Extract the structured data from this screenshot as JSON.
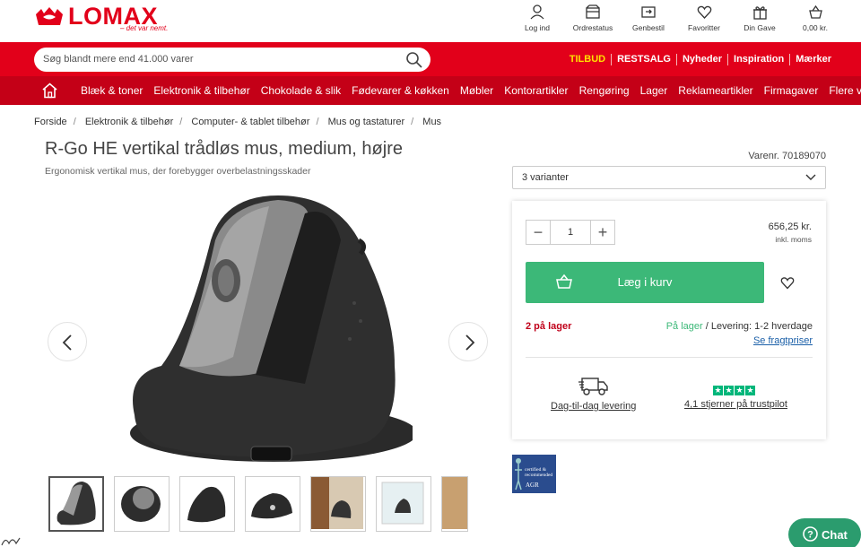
{
  "brand": {
    "name": "LOMAX",
    "tagline": "– det var nemt."
  },
  "header_icons": [
    {
      "label": "Log ind",
      "icon": "user-icon"
    },
    {
      "label": "Ordrestatus",
      "icon": "box-icon"
    },
    {
      "label": "Genbestil",
      "icon": "reorder-icon"
    },
    {
      "label": "Favoritter",
      "icon": "heart-icon"
    },
    {
      "label": "Din Gave",
      "icon": "gift-icon"
    },
    {
      "label": "0,00 kr.",
      "icon": "basket-icon"
    }
  ],
  "search": {
    "placeholder": "Søg blandt mere end 41.000 varer"
  },
  "promo_links": [
    "TILBUD",
    "RESTSALG",
    "Nyheder",
    "Inspiration",
    "Mærker"
  ],
  "categories": [
    "Blæk & toner",
    "Elektronik & tilbehør",
    "Chokolade & slik",
    "Fødevarer & køkken",
    "Møbler",
    "Kontorartikler",
    "Rengøring",
    "Lager",
    "Reklameartikler",
    "Firmagaver",
    "Flere v"
  ],
  "breadcrumb": [
    "Forside",
    "Elektronik & tilbehør",
    "Computer- & tablet tilbehør",
    "Mus og tastaturer",
    "Mus"
  ],
  "product": {
    "title": "R-Go HE vertikal trådløs mus, medium, højre",
    "subtitle": "Ergonomisk vertikal mus, der forebygger overbelastningsskader",
    "varenr": "Varenr. 70189070",
    "variants": "3 varianter",
    "quantity": "1",
    "price": "656,25 kr.",
    "price_note": "inkl. moms",
    "cart_label": "Læg i kurv",
    "stock_count": "2 på lager",
    "stock_status": "På lager",
    "delivery_text": " / Levering: 1-2 hverdage",
    "freight_link": "Se fragtpriser",
    "delivery_label": "Dag-til-dag levering",
    "trustpilot": "4,1 stjerner på trustpilot",
    "badge_text": "certified & recommended",
    "badge_brand": "AGR"
  },
  "chat_label": "Chat",
  "colors": {
    "brand_red": "#e2001a",
    "nav_red": "#c40017",
    "cart_green": "#3cb878",
    "promo_yellow": "#ffe000",
    "trustpilot_green": "#00b67a"
  }
}
